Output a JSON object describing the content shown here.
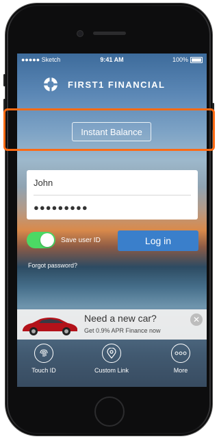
{
  "status_bar": {
    "carrier": "●●●●● Sketch",
    "time": "9:41 AM",
    "battery": "100%"
  },
  "brand": {
    "name": "FIRST1 FINANCIAL",
    "icon": "lifebuoy-icon"
  },
  "instant_balance": {
    "label": "Instant Balance"
  },
  "login": {
    "username_value": "John",
    "password_value": "●●●●●●●●●",
    "save_user_id_label": "Save user ID",
    "save_user_id_on": true,
    "login_label": "Log in",
    "forgot_label": "Forgot password?"
  },
  "ad": {
    "title": "Need a new car?",
    "subtitle": "Get 0.9% APR Finance now",
    "close": "✕"
  },
  "bottom_bar": {
    "items": [
      {
        "label": "Touch ID",
        "icon": "fingerprint-icon"
      },
      {
        "label": "Custom Link",
        "icon": "location-pin-icon"
      },
      {
        "label": "More",
        "icon": "more-dots-icon"
      }
    ]
  },
  "colors": {
    "accent": "#3a7fcb",
    "toggle_on": "#4cd964",
    "highlight": "#ff6a13"
  }
}
